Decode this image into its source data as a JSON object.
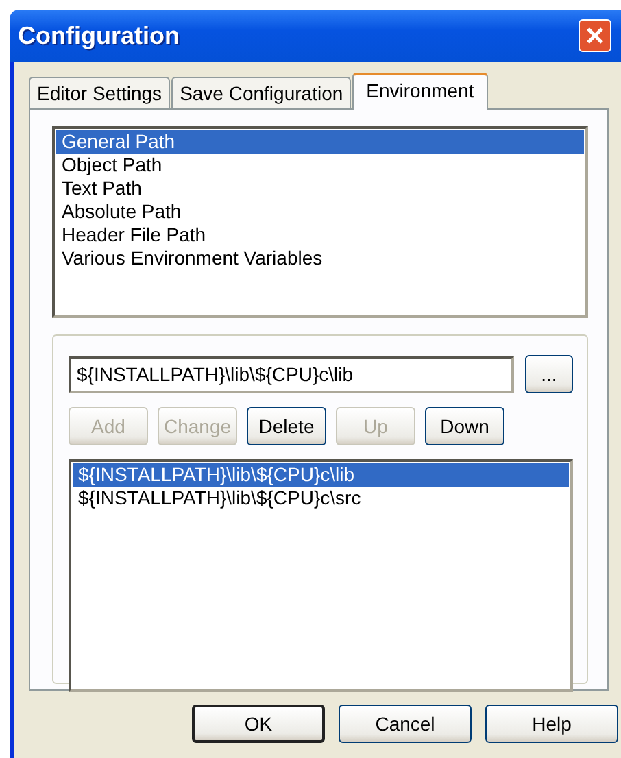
{
  "window": {
    "title": "Configuration"
  },
  "tabs": [
    {
      "label": "Editor Settings",
      "selected": false
    },
    {
      "label": "Save Configuration",
      "selected": false
    },
    {
      "label": "Environment",
      "selected": true
    }
  ],
  "categories": [
    {
      "label": "General Path",
      "selected": true
    },
    {
      "label": "Object Path",
      "selected": false
    },
    {
      "label": "Text Path",
      "selected": false
    },
    {
      "label": "Absolute Path",
      "selected": false
    },
    {
      "label": "Header File Path",
      "selected": false
    },
    {
      "label": "Various Environment Variables",
      "selected": false
    }
  ],
  "path_field": {
    "value": "${INSTALLPATH}\\lib\\${CPU}c\\lib"
  },
  "browse_button": "...",
  "actions": [
    {
      "label": "Add",
      "disabled": true
    },
    {
      "label": "Change",
      "disabled": true
    },
    {
      "label": "Delete",
      "disabled": false
    },
    {
      "label": "Up",
      "disabled": true
    },
    {
      "label": "Down",
      "disabled": false
    }
  ],
  "paths": [
    {
      "label": "${INSTALLPATH}\\lib\\${CPU}c\\lib",
      "selected": true
    },
    {
      "label": "${INSTALLPATH}\\lib\\${CPU}c\\src",
      "selected": false
    }
  ],
  "buttons": [
    {
      "label": "OK",
      "default": true
    },
    {
      "label": "Cancel",
      "default": false
    },
    {
      "label": "Help",
      "default": false
    }
  ]
}
